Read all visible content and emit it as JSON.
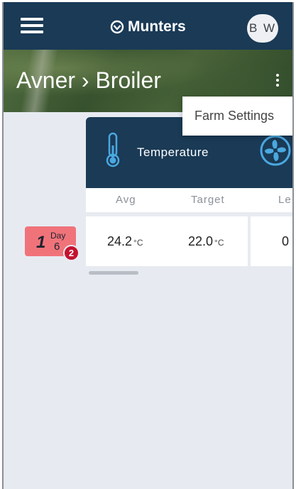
{
  "header": {
    "brand": "Munters",
    "avatar_initials": "B W"
  },
  "hero": {
    "title": "Avner › Broiler"
  },
  "menu": {
    "farm_settings": "Farm Settings"
  },
  "house": {
    "number": "1",
    "day_label": "Day",
    "day_value": "6",
    "alarm_count": "2",
    "color": "#f0737a"
  },
  "card": {
    "title": "Temperature",
    "columns": [
      "Avg",
      "Target",
      "Le"
    ],
    "values": [
      {
        "value": "24.2",
        "unit": "°C"
      },
      {
        "value": "22.0",
        "unit": "°C"
      },
      {
        "value": "0",
        "unit": ""
      }
    ]
  },
  "colors": {
    "header_bg": "#1a3a56",
    "alarm": "#c41230"
  }
}
